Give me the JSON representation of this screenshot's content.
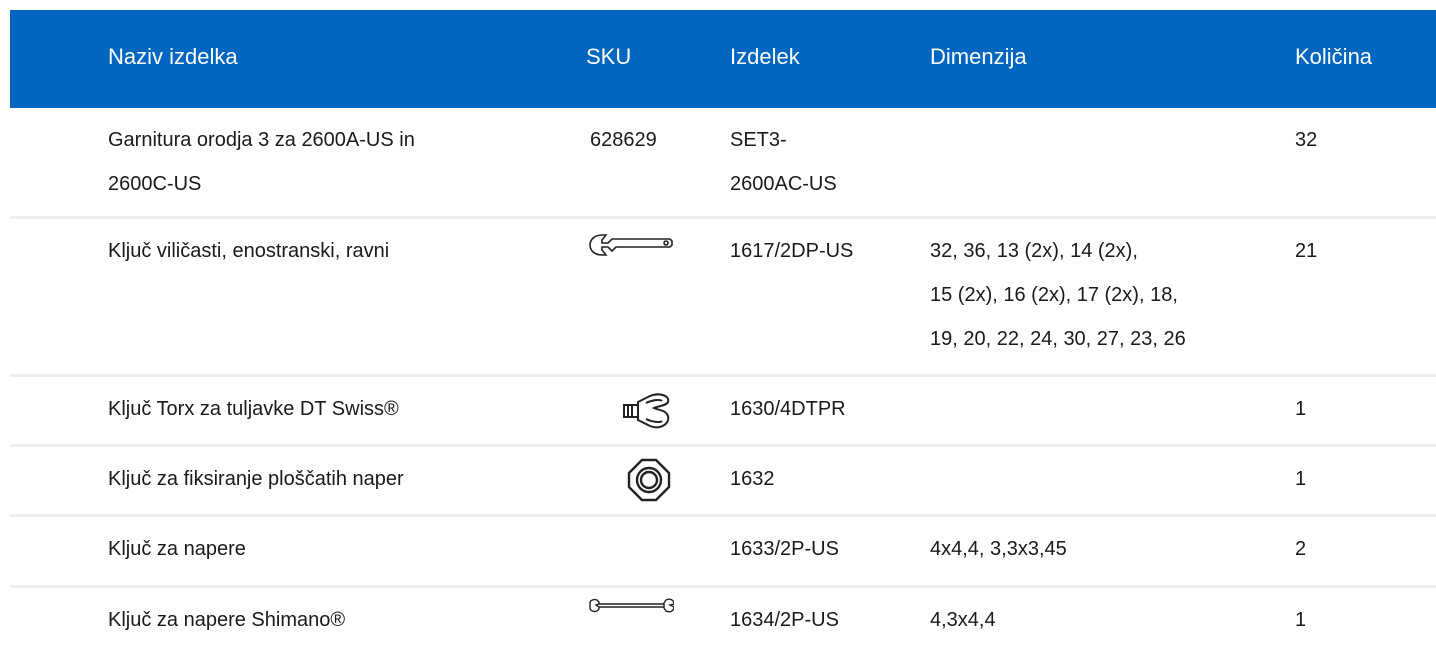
{
  "header": {
    "name": "Naziv izdelka",
    "sku": "SKU",
    "product": "Izdelek",
    "dimension": "Dimenzija",
    "quantity": "Količina"
  },
  "rows": [
    {
      "name_lines": [
        "Garnitura orodja 3 za 2600A-US in",
        "2600C-US"
      ],
      "sku": "628629",
      "product_lines": [
        "SET3-",
        "2600AC-US"
      ],
      "dimension_lines": [],
      "quantity": "32"
    },
    {
      "name_lines": [
        "Ključ viličasti, enostranski, ravni"
      ],
      "sku_icon": "open-end-wrench-icon",
      "product_lines": [
        "1617/2DP-US"
      ],
      "dimension_lines": [
        "32, 36, 13 (2x), 14 (2x),",
        "15 (2x), 16 (2x), 17 (2x), 18,",
        "19, 20, 22, 24, 30, 27, 23, 26"
      ],
      "quantity": "21"
    },
    {
      "name_lines": [
        "Ključ Torx za tuljavke DT Swiss®"
      ],
      "sku_icon": "torx-key-icon",
      "product_lines": [
        "1630/4DTPR"
      ],
      "dimension_lines": [],
      "quantity": "1"
    },
    {
      "name_lines": [
        "Ključ za fiksiranje ploščatih naper"
      ],
      "sku_icon": "flat-spoke-holder-icon",
      "product_lines": [
        "1632"
      ],
      "dimension_lines": [],
      "quantity": "1"
    },
    {
      "name_lines": [
        "Ključ za napere"
      ],
      "product_lines": [
        "1633/2P-US"
      ],
      "dimension_lines": [
        "4x4,4, 3,3x3,45"
      ],
      "quantity": "2"
    },
    {
      "name_lines": [
        "Ključ za napere Shimano®"
      ],
      "sku_icon": "double-spoke-wrench-icon",
      "product_lines": [
        "1634/2P-US"
      ],
      "dimension_lines": [
        "4,3x4,4"
      ],
      "quantity": "1"
    }
  ],
  "colors": {
    "header_bg": "#0066c0",
    "header_text": "#ffffff",
    "divider": "#eeeeee"
  }
}
